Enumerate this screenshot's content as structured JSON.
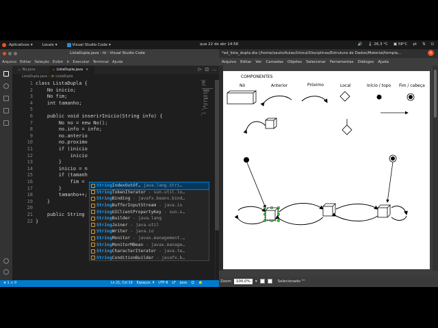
{
  "topbar": {
    "apps": "Aplicativos",
    "places": "Locais",
    "active_app": "Visual Studio Code",
    "clock": "qua 22 de abr  14:56",
    "temp1": "26,3 °C",
    "temp2": "58°C",
    "lang": "pt"
  },
  "vscode": {
    "title": "ListaDupla.java - ld - Visual Studio Code",
    "menu": [
      "Arquivo",
      "Editar",
      "Seleção",
      "Exibir",
      "Ir",
      "Executar",
      "Terminal",
      "Ajuda"
    ],
    "tabs": [
      {
        "label": "No.java"
      },
      {
        "label": "ListaDupla.java"
      }
    ],
    "breadcrumb": [
      "ListaDupla.java",
      "ListaDupla"
    ],
    "lines": [
      {
        "n": "1",
        "text": "class ListaDupla {"
      },
      {
        "n": "2",
        "text": "    No inicio;"
      },
      {
        "n": "3",
        "text": "    No fim;"
      },
      {
        "n": "4",
        "text": "    int tamanho;"
      },
      {
        "n": "5",
        "text": ""
      },
      {
        "n": "6",
        "text": "    public void inserirInicio(String info) {"
      },
      {
        "n": "7",
        "text": "        No no = new No();"
      },
      {
        "n": "8",
        "text": "        no.info = info;"
      },
      {
        "n": "9",
        "text": "        no.anterio"
      },
      {
        "n": "10",
        "text": "        no.proximo"
      },
      {
        "n": "11",
        "text": "        if (inicio"
      },
      {
        "n": "12",
        "text": "            inicio"
      },
      {
        "n": "13",
        "text": "        }"
      },
      {
        "n": "14",
        "text": "        inicio = n"
      },
      {
        "n": "15",
        "text": "        if (tamanh"
      },
      {
        "n": "16",
        "text": "            fim = "
      },
      {
        "n": "17",
        "text": "        }"
      },
      {
        "n": "18",
        "text": "        tamanho++;"
      },
      {
        "n": "19",
        "text": "    }"
      },
      {
        "n": "20",
        "text": ""
      },
      {
        "n": "21",
        "text": "    public String"
      },
      {
        "n": "22",
        "text": "}"
      }
    ],
    "suggestions": [
      {
        "label": "StringIndexOutOf…",
        "detail": "java.lang.Stri…"
      },
      {
        "label": "StringTokenIterator",
        "detail": "- sun.util.lo…"
      },
      {
        "label": "StringBinding",
        "detail": "- javafx.beans.bind…"
      },
      {
        "label": "StringBufferInputStream",
        "detail": "- java.io"
      },
      {
        "label": "StringUIClientPropertyKey",
        "detail": "- sun.s…"
      },
      {
        "label": "StringBuilder",
        "detail": "- java.lang"
      },
      {
        "label": "StringJoiner",
        "detail": "- java.util"
      },
      {
        "label": "StringWriter",
        "detail": "- java.io"
      },
      {
        "label": "StringMonitor",
        "detail": "- javax.management.…"
      },
      {
        "label": "StringMonitorMBean",
        "detail": "- javax.manage…"
      },
      {
        "label": "StringCharacterIterator",
        "detail": "- java.te…"
      },
      {
        "label": "StringConditionBuilder",
        "detail": "- javafx.b…"
      }
    ],
    "status": {
      "branch": "⊗ 1 ⚠ 0",
      "position": "Ln 21, Col 19",
      "spaces": "Espaços: 4",
      "encoding": "UTF-8",
      "eol": "LF",
      "language": "Java"
    }
  },
  "dia": {
    "title": "*ed_lista_dupla.dia (/home/saulo/Aulas/Unisul/Disciplinas/Estrutura de Dados/Material/templa…",
    "menu": [
      "Arquivo",
      "Editar",
      "Ver",
      "Camadas",
      "Objetos",
      "Selecionar",
      "Ferramentas",
      "Diálogos",
      "Ajuda"
    ],
    "canvas": {
      "heading": "COMPONENTES",
      "labels": [
        "Nó",
        "Anterior",
        "Próximo",
        "Local",
        "Início / topo",
        "Fim / cabeça"
      ]
    },
    "status": {
      "zoom_label": "Zoom",
      "zoom_value": "100,0%",
      "selection": "Selecionado \"\""
    }
  }
}
